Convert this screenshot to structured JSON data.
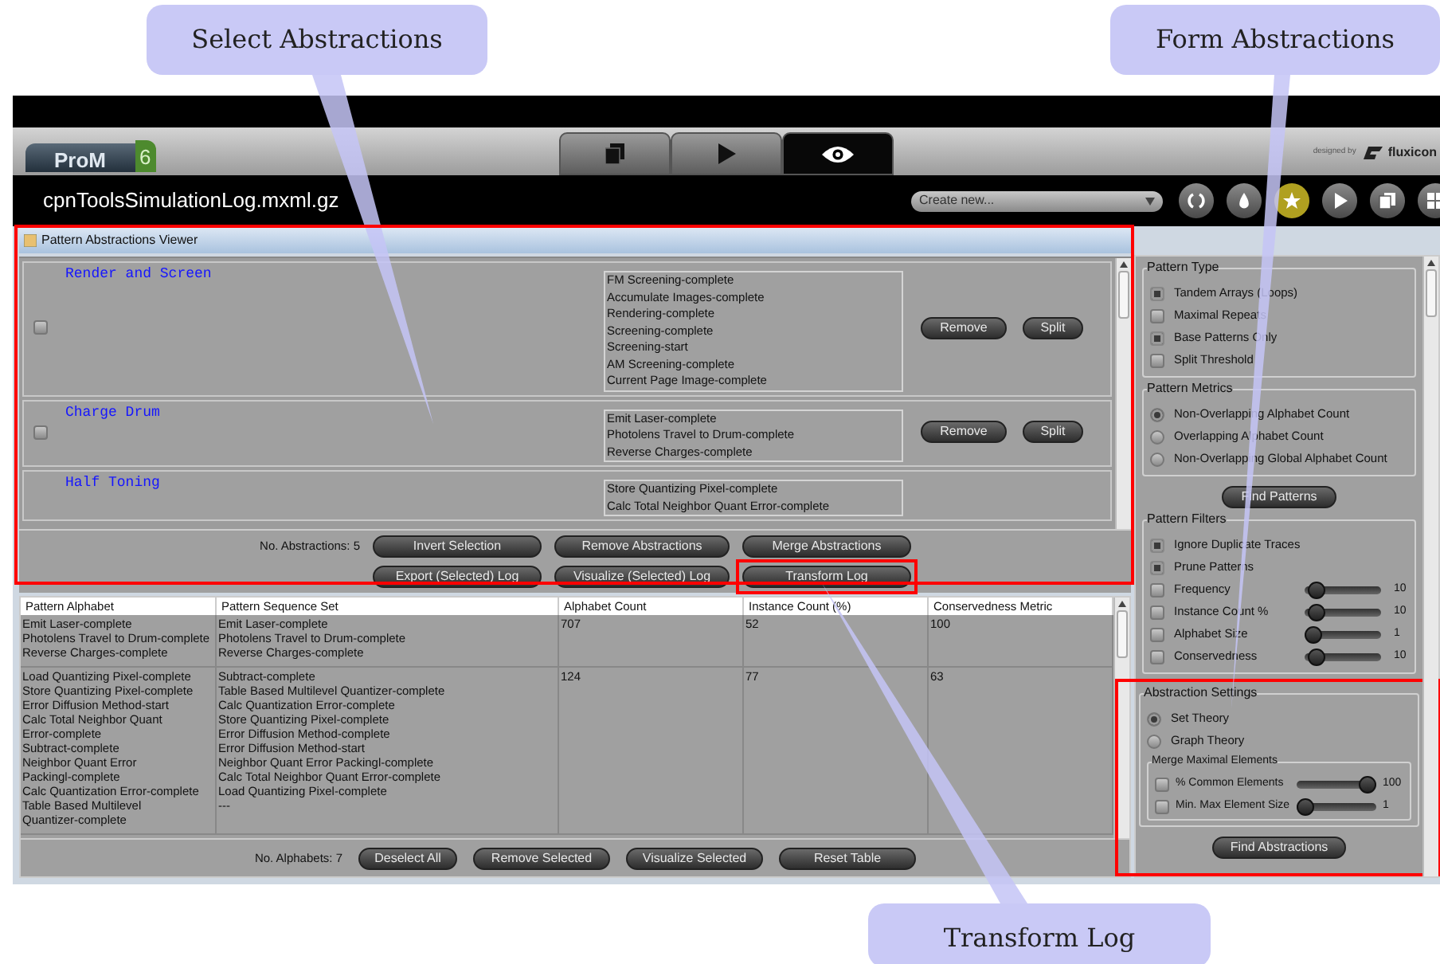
{
  "callouts": [
    {
      "text": "Select Abstractions"
    },
    {
      "text": "Form Abstractions"
    },
    {
      "text": "Transform Log"
    }
  ],
  "app": {
    "logo": "ProM",
    "logo_version": "6",
    "designed_by": "designed by",
    "brand": "fluxicon",
    "filename": "cpnToolsSimulationLog.mxml.gz",
    "create_placeholder": "Create new...",
    "tabs": [
      {
        "kind": "files",
        "selected": false
      },
      {
        "kind": "play",
        "selected": false
      },
      {
        "kind": "view",
        "selected": true
      }
    ]
  },
  "viewer": {
    "title": "Pattern Abstractions Viewer",
    "highlighted": true,
    "abstractions": [
      {
        "name": "Render and Screen",
        "checked": false,
        "activities": [
          "FM Screening-complete",
          "Accumulate Images-complete",
          "Rendering-complete",
          "Screening-complete",
          "Screening-start",
          "AM Screening-complete",
          "Current Page Image-complete"
        ],
        "buttons": [
          "Remove",
          "Split"
        ]
      },
      {
        "name": "Charge Drum",
        "checked": false,
        "activities": [
          "Emit Laser-complete",
          "Photolens Travel to Drum-complete",
          "Reverse Charges-complete"
        ],
        "buttons": [
          "Remove",
          "Split"
        ]
      },
      {
        "name": "Half Toning",
        "activities": [
          "Store Quantizing Pixel-complete",
          "Calc Total Neighbor Quant Error-complete"
        ]
      }
    ],
    "count_label": "No. Abstractions: 5",
    "actions": [
      [
        {
          "label": "Invert Selection",
          "highlighted": false
        },
        {
          "label": "Remove Abstractions",
          "highlighted": false
        },
        {
          "label": "Merge Abstractions",
          "highlighted": false
        }
      ],
      [
        {
          "label": "Export (Selected) Log",
          "highlighted": false
        },
        {
          "label": "Visualize (Selected) Log",
          "highlighted": false
        },
        {
          "label": "Transform Log",
          "highlighted": true
        }
      ]
    ]
  },
  "table": {
    "columns": [
      "Pattern Alphabet",
      "Pattern Sequence Set",
      "Alphabet Count",
      "Instance Count (%)",
      "Conservedness Metric"
    ],
    "rows": [
      {
        "cells": [
          [
            "Emit Laser-complete",
            "Photolens Travel to Drum-complete",
            "Reverse Charges-complete"
          ],
          [
            "Emit Laser-complete",
            "Photolens Travel to Drum-complete",
            "Reverse Charges-complete"
          ],
          [
            "707"
          ],
          [
            "52"
          ],
          [
            "100"
          ]
        ]
      },
      {
        "cells": [
          [
            "Load Quantizing Pixel-complete",
            "Store Quantizing Pixel-complete",
            "Error Diffusion Method-start",
            "Calc Total Neighbor Quant",
            "Error-complete",
            "Subtract-complete",
            "Neighbor Quant Error",
            "Packingl-complete",
            "Calc Quantization Error-complete",
            "Table Based Multilevel",
            "Quantizer-complete"
          ],
          [
            "Subtract-complete",
            "Table Based Multilevel Quantizer-complete",
            "Calc Quantization Error-complete",
            "Store Quantizing Pixel-complete",
            "Error Diffusion Method-complete",
            "Error Diffusion Method-start",
            "Neighbor Quant Error Packingl-complete",
            "Calc Total Neighbor Quant Error-complete",
            "Load Quantizing Pixel-complete",
            "---"
          ],
          [
            "124"
          ],
          [
            "77"
          ],
          [
            "63"
          ]
        ]
      }
    ],
    "count_label": "No. Alphabets: 7",
    "actions": [
      "Deselect All",
      "Remove Selected",
      "Visualize Selected",
      "Reset Table"
    ]
  },
  "settings": {
    "pattern_type": {
      "title": "Pattern Type",
      "options": [
        {
          "label": "Tandem Arrays (Loops)",
          "checked": true
        },
        {
          "label": "Maximal Repeats",
          "checked": false
        },
        {
          "label": "Base Patterns Only",
          "checked": true
        },
        {
          "label": "Split Threshold",
          "checked": false
        }
      ]
    },
    "pattern_metrics": {
      "title": "Pattern Metrics",
      "options": [
        {
          "label": "Non-Overlapping Alphabet Count",
          "selected": true
        },
        {
          "label": "Overlapping Alphabet Count",
          "selected": false
        },
        {
          "label": "Non-Overlapping Global Alphabet Count",
          "selected": false
        }
      ]
    },
    "find_patterns": "Find Patterns",
    "pattern_filters": {
      "title": "Pattern Filters",
      "items": [
        {
          "kind": "checkbox",
          "label": "Ignore Duplicate Traces",
          "checked": true
        },
        {
          "kind": "checkbox",
          "label": "Prune Patterns",
          "checked": true
        },
        {
          "kind": "slider",
          "label": "Frequency",
          "checked": false,
          "level": 0.05,
          "reading": "10"
        },
        {
          "kind": "slider",
          "label": "Instance Count %",
          "checked": false,
          "level": 0.05,
          "reading": "10"
        },
        {
          "kind": "slider",
          "label": "Alphabet Size",
          "checked": false,
          "level": 0,
          "reading": "1"
        },
        {
          "kind": "slider",
          "label": "Conservedness",
          "checked": false,
          "level": 0.05,
          "reading": "10"
        }
      ]
    },
    "abstraction_settings": {
      "title": "Abstraction Settings",
      "highlighted": true,
      "options": [
        {
          "label": "Set Theory",
          "selected": true
        },
        {
          "label": "Graph Theory",
          "selected": false
        }
      ],
      "merge": {
        "title": "Merge Maximal Elements",
        "items": [
          {
            "label": "% Common Elements",
            "checked": false,
            "level": 1,
            "reading": "100"
          },
          {
            "label": "Min. Max Element Size",
            "checked": false,
            "level": 0,
            "reading": "1"
          }
        ]
      },
      "find_button": "Find Abstractions"
    }
  }
}
